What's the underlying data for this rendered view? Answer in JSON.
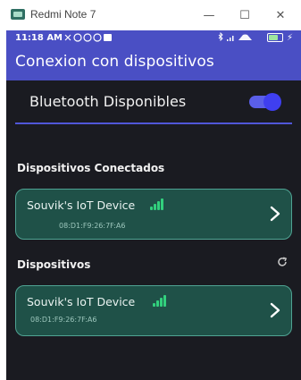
{
  "window": {
    "title": "Redmi Note 7",
    "minimize_glyph": "—",
    "maximize_glyph": "☐",
    "close_glyph": "✕"
  },
  "statusbar": {
    "time": "11:18 AM",
    "left_icons": [
      "mute-icon",
      "alarm-icon",
      "whatsapp-icon",
      "whatsapp-icon",
      "message-icon"
    ],
    "right_icons": [
      "bluetooth-icon",
      "cell-signal-icon",
      "wifi-icon",
      "battery-icon",
      "charging-icon"
    ],
    "battery_level": "50"
  },
  "appbar": {
    "title": "Conexion con dispositivos",
    "color": "#4a4fc4"
  },
  "bluetooth": {
    "label": "Bluetooth Disponibles",
    "enabled": true,
    "toggle_color": "#5a5fe8"
  },
  "sections": {
    "connected_title": "Dispositivos Conectados",
    "devices_title": "Dispositivos"
  },
  "connected_devices": [
    {
      "name": "Souvik's IoT Device",
      "mac": "08:D1:F9:26:7F:A6",
      "signal_bars": 4,
      "icon": "signal-strength-icon"
    }
  ],
  "devices": [
    {
      "name": "Souvik's IoT Device",
      "mac": "08:D1:F9:26:7F:A6",
      "signal_bars": 4,
      "icon": "signal-strength-icon"
    }
  ],
  "colors": {
    "background": "#1a1b21",
    "card_bg": "#1f5148",
    "card_border": "#4fa393",
    "signal": "#32d07d"
  }
}
